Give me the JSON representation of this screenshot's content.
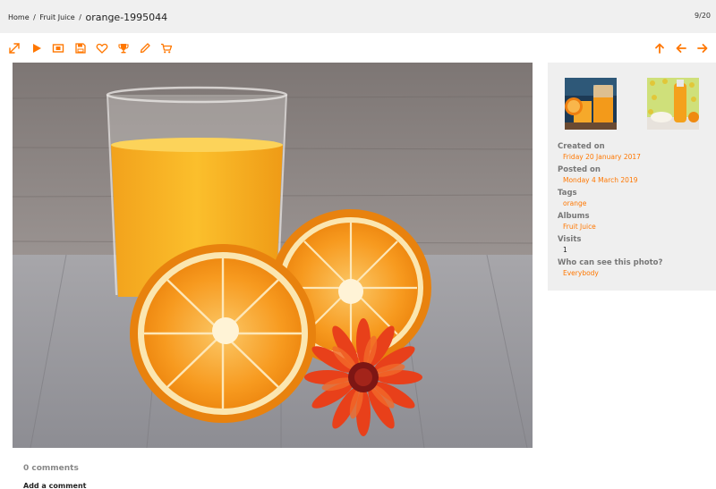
{
  "breadcrumb": {
    "home": "Home",
    "separator": "/",
    "album": "Fruit Juice",
    "current": "orange-1995044"
  },
  "counter": "9/20",
  "toolbar": {
    "left_icons": [
      "expand-icon",
      "play-icon",
      "film-icon",
      "save-icon",
      "heart-icon",
      "trophy-icon",
      "pencil-icon",
      "cart-icon"
    ],
    "right_icons": [
      "arrow-up-icon",
      "arrow-left-icon",
      "arrow-right-icon"
    ],
    "accent_color": "#ff7700"
  },
  "info": {
    "created_label": "Created on",
    "created_value": "Friday 20 January 2017",
    "posted_label": "Posted on",
    "posted_value": "Monday 4 March 2019",
    "tags_label": "Tags",
    "tags_value": "orange",
    "albums_label": "Albums",
    "albums_value": "Fruit Juice",
    "visits_label": "Visits",
    "visits_value": "1",
    "who_label": "Who can see this photo?",
    "who_value": "Everybody"
  },
  "comments": {
    "count_text": "0 comments",
    "add_label": "Add a comment"
  }
}
